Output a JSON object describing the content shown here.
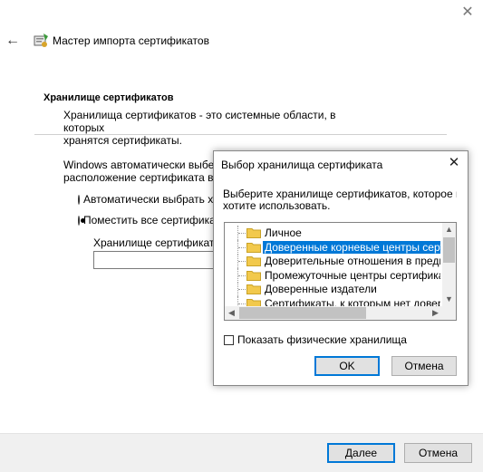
{
  "window": {
    "title": "Мастер импорта сертификатов",
    "close_glyph": "✕",
    "back_glyph": "←"
  },
  "section": {
    "title": "Хранилище сертификатов",
    "desc_line1": "Хранилища сертификатов - это системные области, в которых",
    "desc_line2": "хранятся сертификаты."
  },
  "body": {
    "text_line1": "Windows автоматически выберет",
    "text_line2": "расположение сертификата вручную",
    "radio_auto": "Автоматически выбрать хранилище",
    "radio_manual": "Поместить все сертификаты",
    "store_label": "Хранилище сертификатов"
  },
  "footer": {
    "next_label": "Далее",
    "cancel_label": "Отмена"
  },
  "dialog": {
    "title": "Выбор хранилища сертификата",
    "close_glyph": "✕",
    "desc_line1": "Выберите хранилище сертификатов, которое вы",
    "desc_line2": "хотите использовать.",
    "tree_items": [
      {
        "label": "Личное",
        "selected": false
      },
      {
        "label": "Доверенные корневые центры сертификации",
        "selected": true
      },
      {
        "label": "Доверительные отношения в предприятии",
        "selected": false
      },
      {
        "label": "Промежуточные центры сертификации",
        "selected": false
      },
      {
        "label": "Доверенные издатели",
        "selected": false
      },
      {
        "label": "Сертификаты, к которым нет доверия",
        "selected": false
      }
    ],
    "show_physical_label": "Показать физические хранилища",
    "show_physical_checked": false,
    "ok_label": "OK",
    "cancel_label": "Отмена"
  },
  "colors": {
    "accent": "#0078d7",
    "folder": "#f2c94c"
  }
}
